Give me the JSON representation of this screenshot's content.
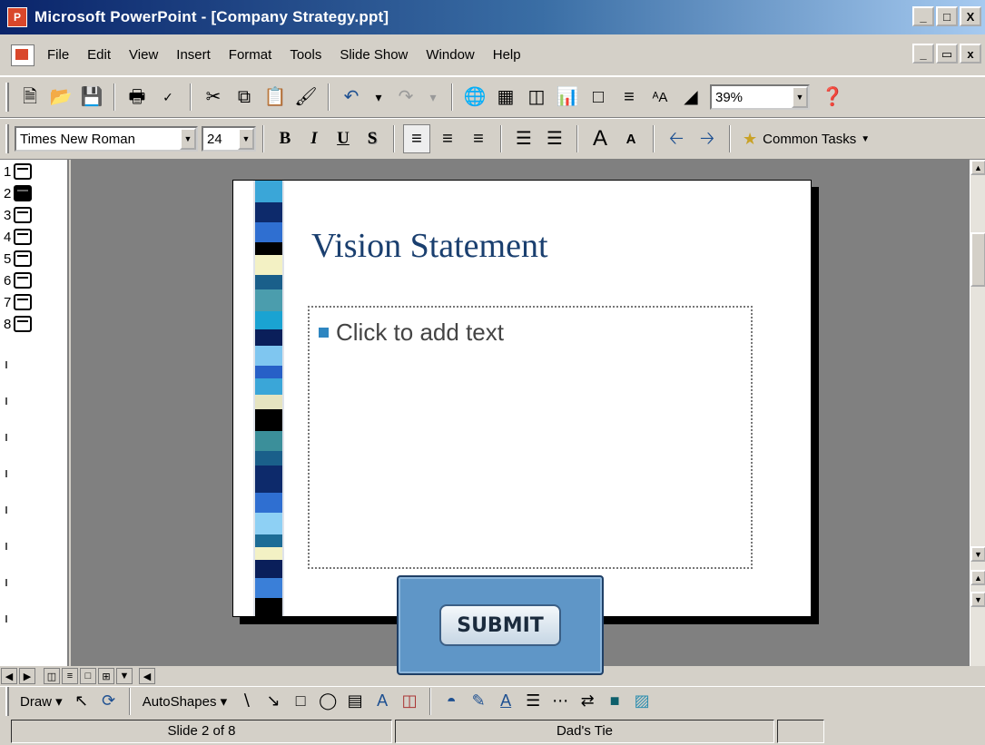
{
  "window": {
    "title": "Microsoft PowerPoint - [Company Strategy.ppt]",
    "min": "_",
    "max": "□",
    "close": "X"
  },
  "menu": {
    "items": [
      "File",
      "Edit",
      "View",
      "Insert",
      "Format",
      "Tools",
      "Slide Show",
      "Window",
      "Help"
    ],
    "doc_controls": [
      "_",
      "ə",
      "x"
    ]
  },
  "toolbar_standard": {
    "zoom_value": "39%",
    "icons": [
      "new-icon",
      "open-icon",
      "save-icon",
      "print-icon",
      "spelling-icon",
      "cut-icon",
      "copy-icon",
      "paste-icon",
      "format-painter-icon",
      "undo-icon",
      "redo-icon",
      "hyperlink-icon",
      "tables-borders-icon",
      "insert-table-icon",
      "insert-chart-icon",
      "new-slide-icon",
      "expand-all-icon",
      "show-formatting-icon",
      "grayscale-icon",
      "help-icon"
    ]
  },
  "toolbar_formatting": {
    "font": "Times New Roman",
    "size": "24",
    "bold": "B",
    "italic": "I",
    "underline": "U",
    "shadow": "S",
    "common_tasks": "Common Tasks"
  },
  "outline": {
    "slides": [
      "1",
      "2",
      "3",
      "4",
      "5",
      "6",
      "7",
      "8"
    ],
    "active": 2
  },
  "slide": {
    "title": "Vision Statement",
    "placeholder": "Click to add text"
  },
  "drawbar": {
    "draw": "Draw",
    "autoshapes": "AutoShapes"
  },
  "status": {
    "slide_info": "Slide 2 of 8",
    "design": "Dad's Tie"
  },
  "overlay": {
    "submit_label": "SUBMIT"
  },
  "colors": {
    "titlebar_start": "#0a246a",
    "slide_title": "#1a3f6f",
    "bullet": "#2e86c1",
    "submit_panel": "#5f96c7"
  }
}
